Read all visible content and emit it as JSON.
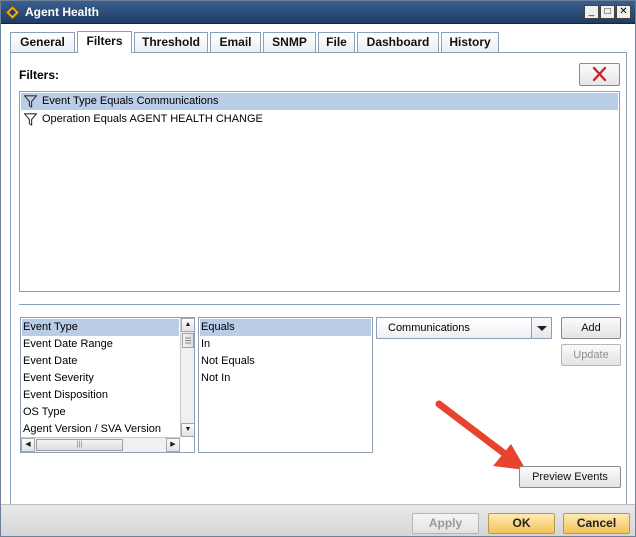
{
  "window": {
    "title": "Agent Health",
    "minimize_glyph": "_",
    "maximize_glyph": "□",
    "close_glyph": "✕"
  },
  "tabs": [
    {
      "label": "General"
    },
    {
      "label": "Filters",
      "active": true
    },
    {
      "label": "Threshold"
    },
    {
      "label": "Email"
    },
    {
      "label": "SNMP"
    },
    {
      "label": "File"
    },
    {
      "label": "Dashboard"
    },
    {
      "label": "History"
    }
  ],
  "filters": {
    "label": "Filters:",
    "items": [
      {
        "text": "Event Type Equals Communications",
        "selected": true
      },
      {
        "text": "Operation Equals AGENT HEALTH CHANGE",
        "selected": false
      }
    ]
  },
  "fields": {
    "items": [
      {
        "text": "Event Type",
        "selected": true
      },
      {
        "text": "Event Date Range"
      },
      {
        "text": "Event Date"
      },
      {
        "text": "Event Severity"
      },
      {
        "text": "Event Disposition"
      },
      {
        "text": "OS Type"
      },
      {
        "text": "Agent Version / SVA Version"
      }
    ]
  },
  "operators": {
    "items": [
      {
        "text": "Equals",
        "selected": true
      },
      {
        "text": "In"
      },
      {
        "text": "Not Equals"
      },
      {
        "text": "Not In"
      }
    ]
  },
  "value_combo": {
    "selected": "Communications"
  },
  "buttons": {
    "add": "Add",
    "update": "Update",
    "preview": "Preview Events"
  },
  "footer": {
    "apply": "Apply",
    "ok": "OK",
    "cancel": "Cancel"
  },
  "colors": {
    "titlebar": "#1e3d66",
    "selection": "#b9cde6",
    "annotation_arrow": "#e8432f",
    "delete_x": "#c8262a"
  }
}
